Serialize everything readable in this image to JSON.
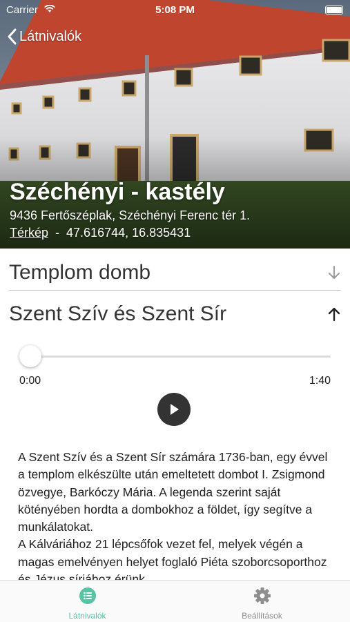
{
  "status_bar": {
    "carrier": "Carrier",
    "time": "5:08 PM"
  },
  "nav": {
    "back_label": "Látnivalók"
  },
  "place": {
    "title": "Széchényi - kastély",
    "address": "9436 Fertőszéplak, Széchényi Ferenc tér 1.",
    "map_link": "Térkép",
    "separator": "-",
    "coordinates": "47.616744, 16.835431"
  },
  "sections": [
    {
      "title": "Templom domb",
      "state": "collapsed",
      "icon": "arrow-down-icon"
    },
    {
      "title": "Szent Szív és Szent Sír",
      "state": "expanded",
      "icon": "arrow-up-icon"
    }
  ],
  "player": {
    "current_time": "0:00",
    "total_time": "1:40",
    "progress": 0
  },
  "description": [
    "A Szent Szív és a Szent Sír számára 1736-ban, egy évvel a templom elkészülte után emeltetett dombot I. Zsigmond özvegye, Barkóczy Mária. A legenda szerint saját kötényében hordta a dombokhoz a földet, így segítve a munkálatokat.",
    "A Kálváriához 21 lépcsőfok vezet fel, melyek végén a magas emelvényen helyet foglaló Piéta szoborcsoporthoz és Jézus sírjához érünk."
  ],
  "tabs": [
    {
      "label": "Látnivalók",
      "icon": "list-icon",
      "active": true
    },
    {
      "label": "Beállítások",
      "icon": "gear-icon",
      "active": false
    }
  ],
  "colors": {
    "accent": "#59c3a6",
    "inactive_tab": "#8e8e8e",
    "player": "#333333"
  }
}
